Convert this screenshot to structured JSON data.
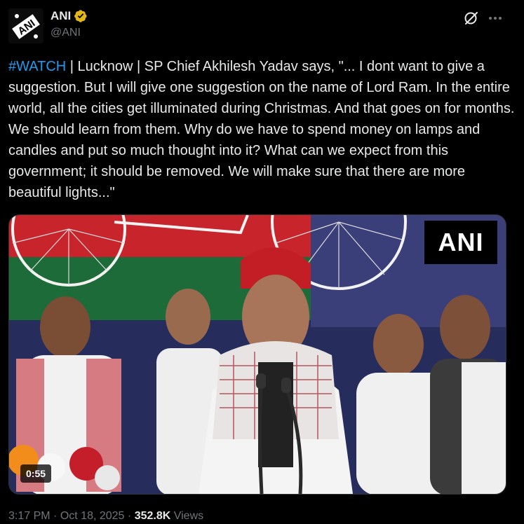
{
  "author": {
    "name": "ANI",
    "handle": "@ANI",
    "verified_color": "#e2b719",
    "avatar_text": "ANI"
  },
  "tweet": {
    "hashtag": "#WATCH",
    "text": " | Lucknow | SP Chief Akhilesh Yadav says, \"... I dont want to give a suggestion. But I will give one suggestion on the name of Lord Ram. In the entire world, all the cities get illuminated during Christmas. And that goes on for months. We should learn from them. Why do we have to spend money on lamps and candles and put so much thought into it? What can we expect from this government; it should be removed. We will make sure that there are more beautiful lights...\""
  },
  "media": {
    "watermark": "ANI",
    "duration": "0:55"
  },
  "meta": {
    "time": "3:17 PM",
    "separator": "·",
    "date": "Oct 18, 2025",
    "views_count": "352.8K",
    "views_label": "Views"
  },
  "icons": {
    "grok": "grok-icon",
    "more": "more-icon",
    "verified": "verified-badge-icon"
  },
  "colors": {
    "background": "#000000",
    "text": "#e7e9ea",
    "secondary": "#71767b",
    "link": "#1d9bf0"
  }
}
